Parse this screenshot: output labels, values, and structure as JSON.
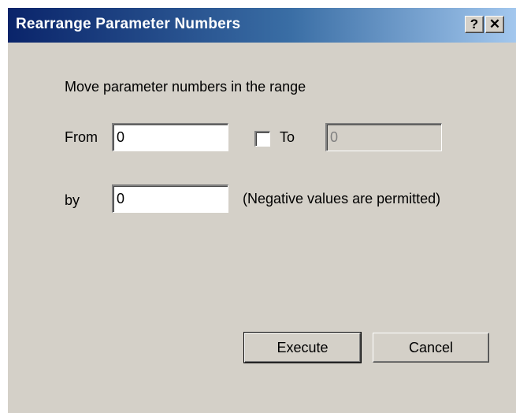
{
  "window": {
    "title": "Rearrange Parameter Numbers",
    "help_label": "?",
    "close_label": "✕"
  },
  "form": {
    "instruction": "Move parameter numbers in the range",
    "from_label": "From",
    "from_value": "0",
    "to_checkbox_checked": false,
    "to_label": "To",
    "to_value": "0",
    "to_enabled": false,
    "by_label": "by",
    "by_value": "0",
    "by_hint": "(Negative values are permitted)"
  },
  "buttons": {
    "execute_label": "Execute",
    "cancel_label": "Cancel"
  }
}
